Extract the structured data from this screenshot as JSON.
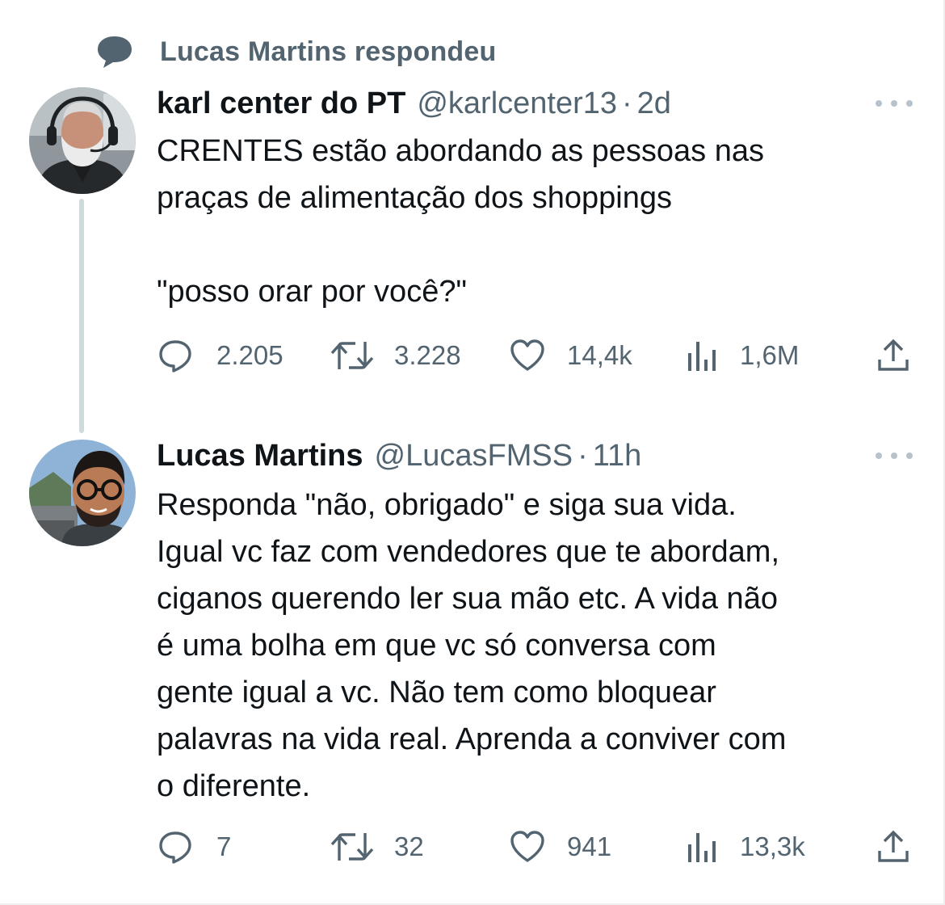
{
  "social_context": {
    "icon": "speech-bubble-icon",
    "text": "Lucas Martins respondeu"
  },
  "colors": {
    "text_primary": "#0f1419",
    "text_secondary": "#536471",
    "thread_line": "#cfd9de",
    "icon_gray": "#536471"
  },
  "tweets": [
    {
      "name": "karl center do PT",
      "handle": "@karlcenter13",
      "separator": "·",
      "time": "2d",
      "text": "CRENTES estão abordando as pessoas nas\npraças de alimentação dos shoppings\n\n\"posso orar por você?\"",
      "replies": "2.205",
      "retweets": "3.228",
      "likes": "14,4k",
      "views": "1,6M"
    },
    {
      "name": "Lucas Martins",
      "handle": "@LucasFMSS",
      "separator": "·",
      "time": "11h",
      "text": "Responda \"não, obrigado\" e siga sua vida.\nIgual vc faz com vendedores que te abordam,\nciganos querendo ler sua mão etc. A vida não\né uma bolha em que vc só conversa com\ngente igual a vc. Não tem como bloquear\npalavras na vida real. Aprenda a conviver com\no diferente.",
      "replies": "7",
      "retweets": "32",
      "likes": "941",
      "views": "13,3k"
    }
  ]
}
